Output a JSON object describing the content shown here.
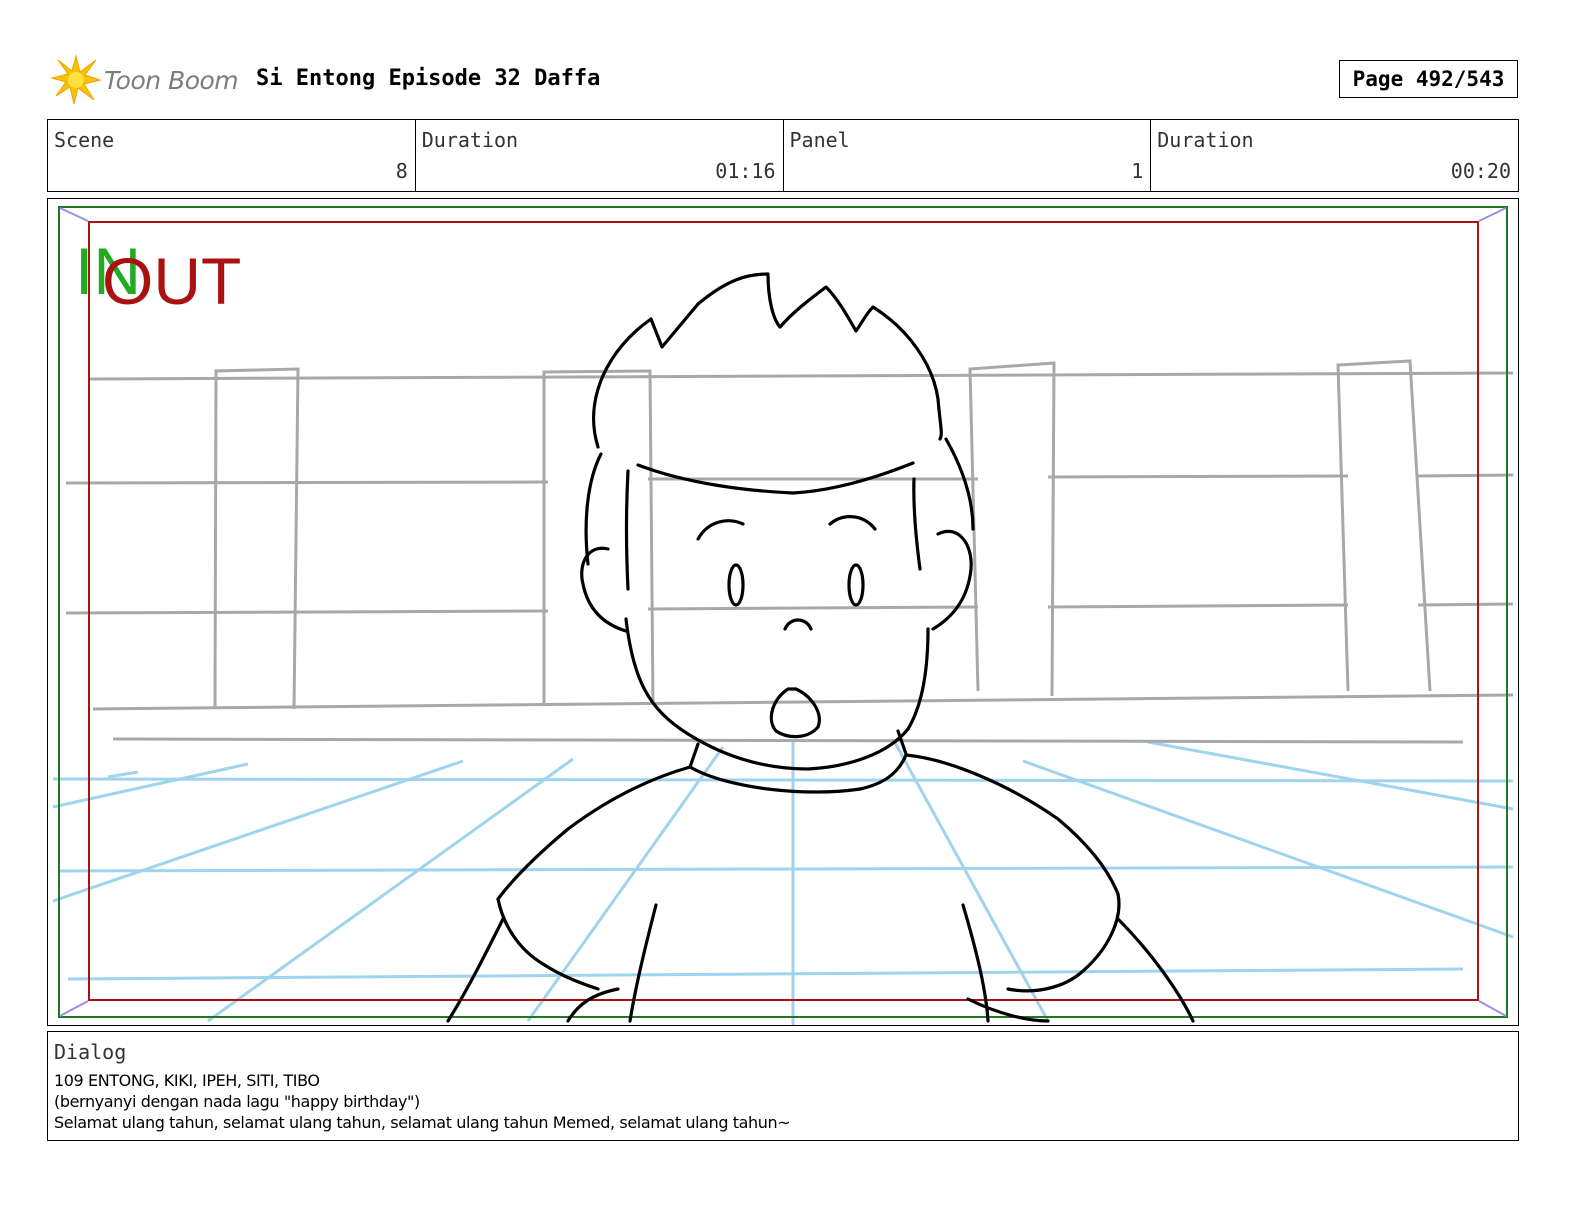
{
  "header": {
    "logo_text": "Toon Boom",
    "project_title": "Si Entong Episode 32 Daffa",
    "page_label": "Page 492/543"
  },
  "info": {
    "scene_label": "Scene",
    "scene_value": "8",
    "scene_duration_label": "Duration",
    "scene_duration_value": "01:16",
    "panel_label": "Panel",
    "panel_value": "1",
    "panel_duration_label": "Duration",
    "panel_duration_value": "00:20"
  },
  "panel": {
    "in_marker": "IN",
    "out_marker": "OUT",
    "colors": {
      "in": "#22aa22",
      "out": "#aa1111",
      "safe_frame": "#aa1111",
      "outer_frame": "#227722",
      "guides": "#9fd3ee",
      "background_lines": "#a8a8a8"
    }
  },
  "dialog": {
    "label": "Dialog",
    "lines": [
      "109 ENTONG, KIKI, IPEH, SITI, TIBO",
      "(bernyanyi dengan nada lagu \"happy birthday\")",
      "Selamat ulang tahun, selamat ulang tahun, selamat ulang tahun Memed, selamat ulang tahun~"
    ]
  }
}
